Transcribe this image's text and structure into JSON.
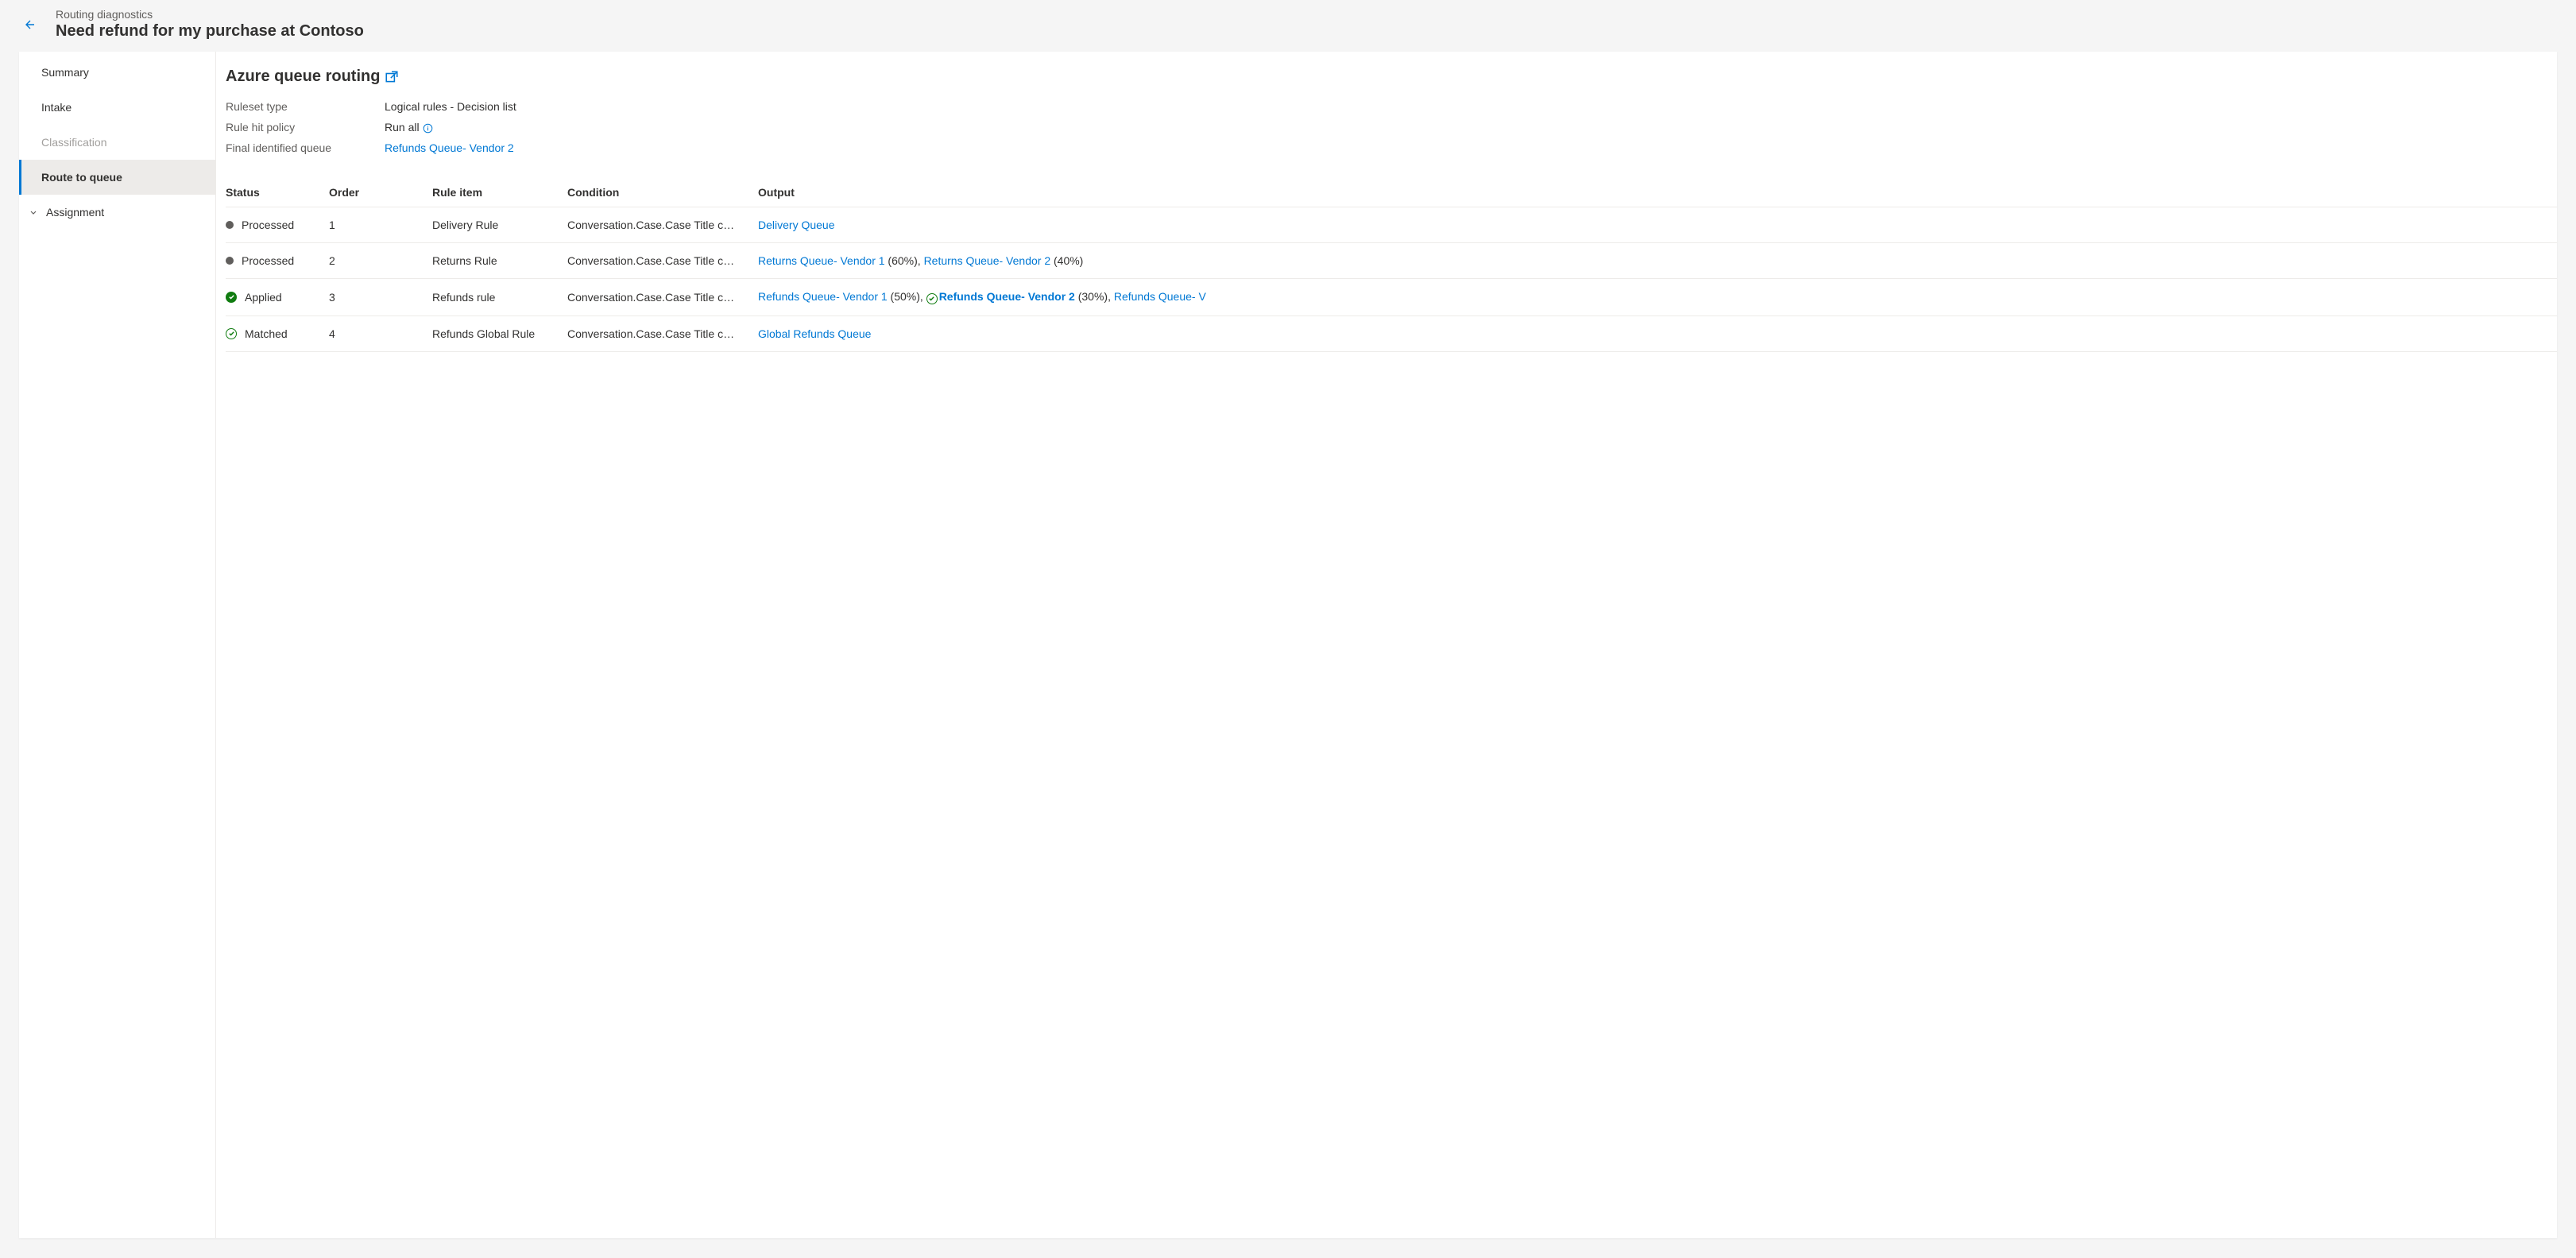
{
  "header": {
    "crumb": "Routing diagnostics",
    "title": "Need refund for my purchase at Contoso"
  },
  "sidebar": {
    "items": [
      {
        "label": "Summary",
        "state": "normal"
      },
      {
        "label": "Intake",
        "state": "normal"
      },
      {
        "label": "Classification",
        "state": "disabled"
      },
      {
        "label": "Route to queue",
        "state": "selected"
      },
      {
        "label": "Assignment",
        "state": "exp"
      }
    ]
  },
  "page": {
    "title": "Azure queue routing",
    "kv": [
      {
        "label": "Ruleset type",
        "value": "Logical rules - Decision list",
        "link": false,
        "info": false
      },
      {
        "label": "Rule hit policy",
        "value": "Run all",
        "link": false,
        "info": true
      },
      {
        "label": "Final identified queue",
        "value": "Refunds Queue- Vendor 2",
        "link": true,
        "info": false
      }
    ]
  },
  "table": {
    "headers": [
      "Status",
      "Order",
      "Rule item",
      "Condition",
      "Output"
    ],
    "rows": [
      {
        "statusIcon": "dot",
        "status": "Processed",
        "order": "1",
        "rule": "Delivery Rule",
        "condition": "Conversation.Case.Case Title c…",
        "outputs": [
          {
            "text": "Delivery Queue",
            "link": true
          }
        ]
      },
      {
        "statusIcon": "dot",
        "status": "Processed",
        "order": "2",
        "rule": "Returns Rule",
        "condition": "Conversation.Case.Case Title c…",
        "outputs": [
          {
            "text": "Returns Queue- Vendor 1",
            "link": true
          },
          {
            "text": " (60%), ",
            "link": false
          },
          {
            "text": "Returns Queue- Vendor 2",
            "link": true
          },
          {
            "text": " (40%)",
            "link": false
          }
        ]
      },
      {
        "statusIcon": "check-solid",
        "status": "Applied",
        "order": "3",
        "rule": "Refunds rule",
        "condition": "Conversation.Case.Case Title c…",
        "outputs": [
          {
            "text": "Refunds Queue- Vendor 1",
            "link": true
          },
          {
            "text": " (50%), ",
            "link": false
          },
          {
            "icon": "check-outline"
          },
          {
            "text": "Refunds Queue- Vendor 2",
            "link": true,
            "bold": true
          },
          {
            "text": " (30%), ",
            "link": false
          },
          {
            "text": "Refunds Queue- V",
            "link": true
          }
        ]
      },
      {
        "statusIcon": "check-outline",
        "status": "Matched",
        "order": "4",
        "rule": "Refunds Global Rule",
        "condition": "Conversation.Case.Case Title c…",
        "outputs": [
          {
            "text": "Global Refunds Queue",
            "link": true
          }
        ]
      }
    ]
  }
}
